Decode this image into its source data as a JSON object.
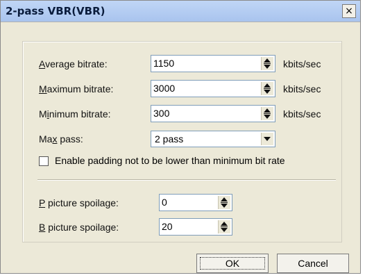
{
  "window": {
    "title": "2-pass VBR(VBR)",
    "close_glyph": "×"
  },
  "bitrates": [
    {
      "label_pre": "",
      "mnemonic": "A",
      "label_post": "verage bitrate:",
      "value": "1150",
      "unit": "kbits/sec"
    },
    {
      "label_pre": "",
      "mnemonic": "M",
      "label_post": "aximum bitrate:",
      "value": "3000",
      "unit": "kbits/sec"
    },
    {
      "label_pre": "M",
      "mnemonic": "i",
      "label_post": "nimum bitrate:",
      "value": "300",
      "unit": "kbits/sec"
    }
  ],
  "max_pass": {
    "label_pre": "Ma",
    "mnemonic": "x",
    "label_post": " pass:",
    "value": "2 pass"
  },
  "padding": {
    "label": "Enable padding not to be lower than minimum bit rate",
    "checked": false
  },
  "spoilage": [
    {
      "mnemonic": "P",
      "label_post": " picture spoilage:",
      "value": "0"
    },
    {
      "mnemonic": "B",
      "label_post": " picture spoilage:",
      "value": "20"
    }
  ],
  "buttons": {
    "ok": "OK",
    "cancel": "Cancel"
  }
}
